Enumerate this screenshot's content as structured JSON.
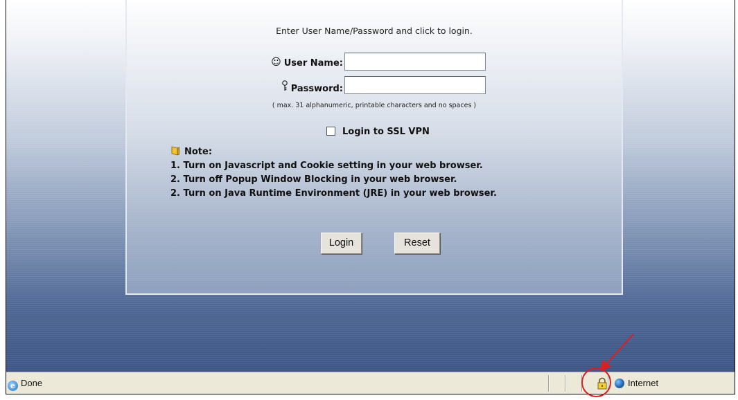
{
  "login": {
    "instruction": "Enter User Name/Password and click to login.",
    "username_label": "User Name:",
    "username_value": "",
    "password_label": "Password:",
    "password_value": "",
    "hint": "( max. 31 alphanumeric, printable characters and no spaces )",
    "ssl_checkbox_label": "Login to SSL VPN",
    "ssl_checked": false,
    "login_button": "Login",
    "reset_button": "Reset"
  },
  "note": {
    "title": "Note:",
    "lines": [
      "1. Turn on Javascript and Cookie setting in your web browser.",
      "2. Turn off Popup Window Blocking in your web browser.",
      "2. Turn on Java Runtime Environment (JRE) in your web browser."
    ]
  },
  "statusbar": {
    "status_text": "Done",
    "zone_text": "Internet"
  },
  "icons": {
    "user": "smiley-icon",
    "password": "key-icon",
    "note": "note-icon",
    "browser": "ie-page-icon",
    "lock": "padlock-icon",
    "zone": "globe-icon"
  },
  "colors": {
    "callout": "#e01d1d",
    "statusbar": "#ece9d8"
  }
}
